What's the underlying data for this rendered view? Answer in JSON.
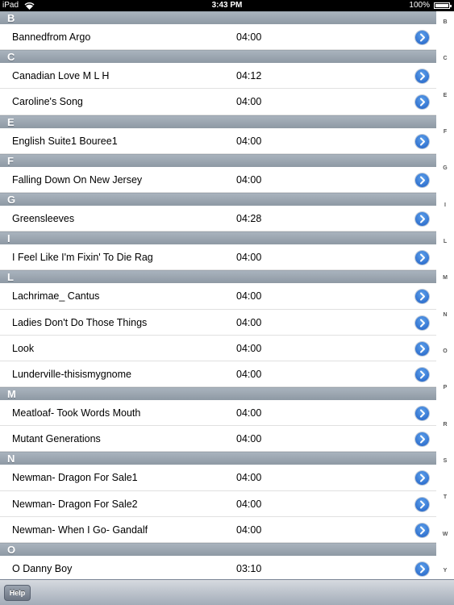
{
  "status_bar": {
    "carrier": "iPad",
    "time": "3:43 PM",
    "battery": "100%",
    "battery_level": 1.0
  },
  "sections": [
    {
      "letter": "B",
      "rows": [
        {
          "title": "Bannedfrom Argo",
          "duration": "04:00"
        }
      ]
    },
    {
      "letter": "C",
      "rows": [
        {
          "title": "Canadian  Love  M L H",
          "duration": "04:12"
        },
        {
          "title": "Caroline's  Song",
          "duration": "04:00"
        }
      ]
    },
    {
      "letter": "E",
      "rows": [
        {
          "title": "English Suite1 Bouree1",
          "duration": "04:00"
        }
      ]
    },
    {
      "letter": "F",
      "rows": [
        {
          "title": "Falling  Down  On  New  Jersey",
          "duration": "04:00"
        }
      ]
    },
    {
      "letter": "G",
      "rows": [
        {
          "title": "Greensleeves",
          "duration": "04:28"
        }
      ]
    },
    {
      "letter": "I",
      "rows": [
        {
          "title": "I Feel Like I'm Fixin' To Die Rag",
          "duration": "04:00"
        }
      ]
    },
    {
      "letter": "L",
      "rows": [
        {
          "title": "Lachrimae_ Cantus",
          "duration": "04:00"
        },
        {
          "title": "Ladies Don't Do Those Things",
          "duration": "04:00"
        },
        {
          "title": "Look",
          "duration": "04:00"
        },
        {
          "title": "Lunderville-thisismygnome",
          "duration": "04:00"
        }
      ]
    },
    {
      "letter": "M",
      "rows": [
        {
          "title": "Meatloaf- Took Words Mouth",
          "duration": "04:00"
        },
        {
          "title": "Mutant Generations",
          "duration": "04:00"
        }
      ]
    },
    {
      "letter": "N",
      "rows": [
        {
          "title": "Newman- Dragon For Sale1",
          "duration": "04:00"
        },
        {
          "title": "Newman- Dragon For Sale2",
          "duration": "04:00"
        },
        {
          "title": "Newman- When I Go- Gandalf",
          "duration": "04:00"
        }
      ]
    },
    {
      "letter": "O",
      "rows": [
        {
          "title": "O Danny Boy",
          "duration": "03:10"
        }
      ]
    }
  ],
  "index_letters": [
    "B",
    "C",
    "E",
    "F",
    "G",
    "I",
    "L",
    "M",
    "N",
    "O",
    "P",
    "R",
    "S",
    "T",
    "W",
    "Y"
  ],
  "toolbar": {
    "help_label": "Help"
  }
}
